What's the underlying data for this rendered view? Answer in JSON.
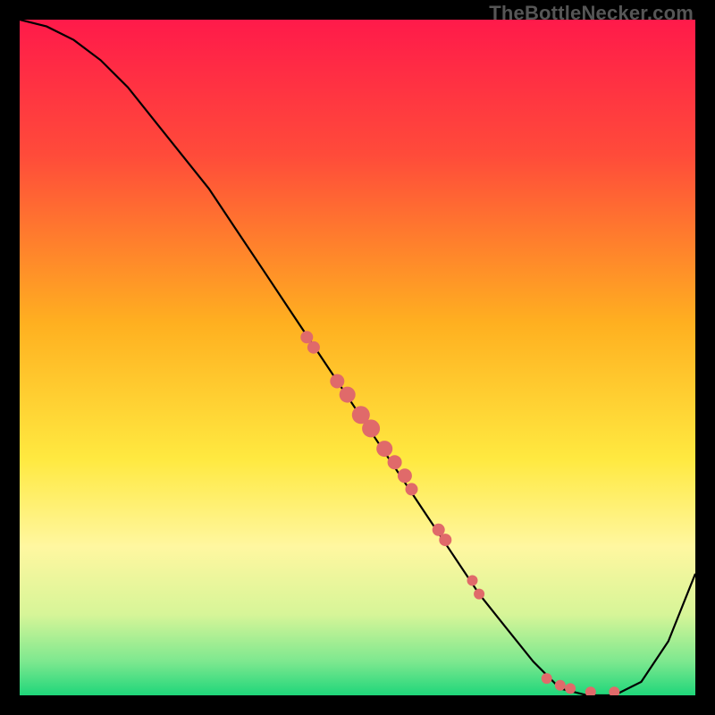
{
  "watermark": "TheBottleNecker.com",
  "chart_data": {
    "type": "line",
    "title": "",
    "xlabel": "",
    "ylabel": "",
    "xlim": [
      0,
      100
    ],
    "ylim": [
      0,
      100
    ],
    "grid": false,
    "legend": false,
    "background": {
      "type": "vertical-gradient",
      "stops": [
        {
          "pos": 0.0,
          "color": "#ff1a4a"
        },
        {
          "pos": 0.2,
          "color": "#ff4b3a"
        },
        {
          "pos": 0.45,
          "color": "#ffb020"
        },
        {
          "pos": 0.65,
          "color": "#ffe940"
        },
        {
          "pos": 0.78,
          "color": "#fff7a0"
        },
        {
          "pos": 0.88,
          "color": "#d7f598"
        },
        {
          "pos": 0.95,
          "color": "#7de88f"
        },
        {
          "pos": 1.0,
          "color": "#1fd67a"
        }
      ]
    },
    "series": [
      {
        "name": "bottleneck-curve",
        "color": "#000000",
        "x": [
          0,
          4,
          8,
          12,
          16,
          20,
          24,
          28,
          32,
          36,
          40,
          44,
          48,
          52,
          56,
          60,
          64,
          68,
          72,
          76,
          80,
          84,
          88,
          92,
          96,
          100
        ],
        "y": [
          100,
          99,
          97,
          94,
          90,
          85,
          80,
          75,
          69,
          63,
          57,
          51,
          45,
          39,
          33,
          27,
          21,
          15,
          10,
          5,
          1,
          0,
          0,
          2,
          8,
          18
        ]
      }
    ],
    "scatter": [
      {
        "name": "points-on-curve",
        "color": "#e06a6a",
        "marker": "circle",
        "size_groups": [
          {
            "x": 42.5,
            "y": 53,
            "r": 7
          },
          {
            "x": 43.5,
            "y": 51.5,
            "r": 7
          },
          {
            "x": 47.0,
            "y": 46.5,
            "r": 8
          },
          {
            "x": 48.5,
            "y": 44.5,
            "r": 9
          },
          {
            "x": 50.5,
            "y": 41.5,
            "r": 10
          },
          {
            "x": 52.0,
            "y": 39.5,
            "r": 10
          },
          {
            "x": 54.0,
            "y": 36.5,
            "r": 9
          },
          {
            "x": 55.5,
            "y": 34.5,
            "r": 8
          },
          {
            "x": 57.0,
            "y": 32.5,
            "r": 8
          },
          {
            "x": 58.0,
            "y": 30.5,
            "r": 7
          },
          {
            "x": 62.0,
            "y": 24.5,
            "r": 7
          },
          {
            "x": 63.0,
            "y": 23.0,
            "r": 7
          },
          {
            "x": 67.0,
            "y": 17.0,
            "r": 6
          },
          {
            "x": 68.0,
            "y": 15.0,
            "r": 6
          },
          {
            "x": 78.0,
            "y": 2.5,
            "r": 6
          },
          {
            "x": 80.0,
            "y": 1.5,
            "r": 6
          },
          {
            "x": 81.5,
            "y": 1.0,
            "r": 6
          },
          {
            "x": 84.5,
            "y": 0.5,
            "r": 6
          },
          {
            "x": 88.0,
            "y": 0.5,
            "r": 6
          }
        ]
      }
    ]
  }
}
